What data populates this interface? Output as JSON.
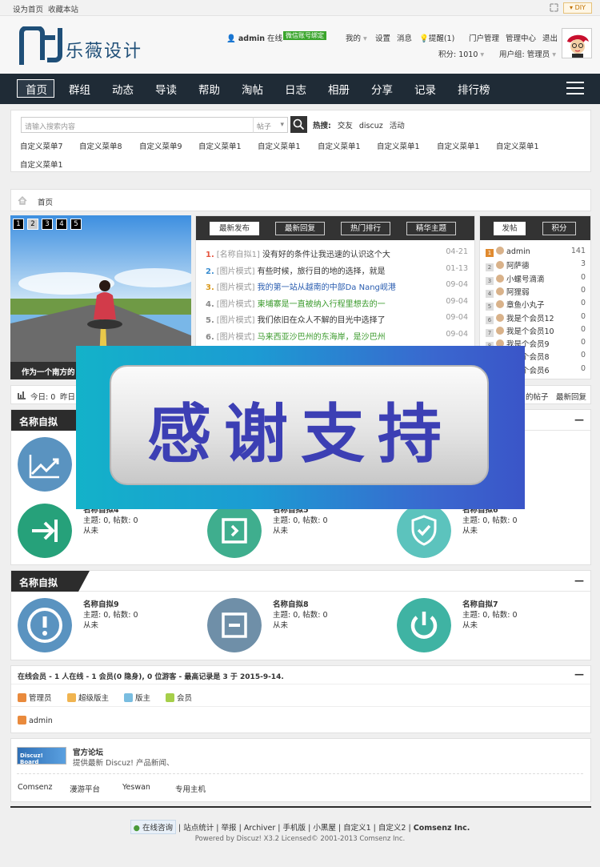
{
  "topbar": {
    "set_home": "设为首页",
    "bookmark": "收藏本站",
    "diy": "DIY"
  },
  "header": {
    "logo_text": "乐薇设计",
    "user": "admin",
    "online": "在线",
    "wechat": "微信账号绑定",
    "my": "我的",
    "settings": "设置",
    "messages": "消息",
    "remind": "提醒(1)",
    "portal_admin": "门户管理",
    "admin_center": "管理中心",
    "logout": "退出",
    "points": "积分: 1010",
    "usergroup": "用户组: 管理员"
  },
  "nav": [
    "首页",
    "群组",
    "动态",
    "导读",
    "帮助",
    "淘帖",
    "日志",
    "相册",
    "分享",
    "记录",
    "排行榜"
  ],
  "search": {
    "placeholder": "请输入搜索内容",
    "type": "帖子",
    "hot_label": "热搜:",
    "hot": [
      "交友",
      "discuz",
      "活动"
    ]
  },
  "menus": [
    "自定义菜单7",
    "自定义菜单8",
    "自定义菜单9",
    "自定义菜单1",
    "自定义菜单1",
    "自定义菜单1",
    "自定义菜单1",
    "自定义菜单1",
    "自定义菜单1",
    "自定义菜单1"
  ],
  "breadcrumb": "首页",
  "slider": {
    "dots": [
      "1",
      "2",
      "3",
      "4",
      "5"
    ],
    "caption": "作为一个南方的"
  },
  "center_tabs": [
    "最新发布",
    "最新回复",
    "热门排行",
    "精华主题"
  ],
  "threads": [
    {
      "n": "1.",
      "cat": "[名称自拟1]",
      "title": "没有好的条件让我迅速的认识这个大",
      "date": "04-21",
      "color": "#333",
      "numc": "#e5553f"
    },
    {
      "n": "2.",
      "cat": "[图片模式]",
      "title": "有些时候，旅行目的地的选择，就是",
      "date": "01-13",
      "color": "#333",
      "numc": "#3a8dd0"
    },
    {
      "n": "3.",
      "cat": "[图片模式]",
      "title": "我的第一站从越南的中部Da Nang岘港",
      "date": "09-04",
      "color": "#2a5db0",
      "numc": "#d99a1e"
    },
    {
      "n": "4.",
      "cat": "[图片模式]",
      "title": "柬埔寨是一直被纳入行程里想去的一",
      "date": "09-04",
      "color": "#3a9a2b",
      "numc": "#888"
    },
    {
      "n": "5.",
      "cat": "[图片模式]",
      "title": "我们依旧在众人不解的目光中选择了",
      "date": "09-04",
      "color": "#333",
      "numc": "#888"
    },
    {
      "n": "6.",
      "cat": "[图片模式]",
      "title": "马来西亚沙巴州的东海岸，是沙巴州",
      "date": "09-04",
      "color": "#3a9a2b",
      "numc": "#888"
    }
  ],
  "right_tabs": [
    "发帖",
    "积分"
  ],
  "ranks": [
    {
      "k": "1",
      "name": "admin",
      "count": "141"
    },
    {
      "k": "2",
      "name": "阿萨德",
      "count": "3"
    },
    {
      "k": "3",
      "name": "小螺号滴滴",
      "count": "0"
    },
    {
      "k": "4",
      "name": "阿狸弱",
      "count": "0"
    },
    {
      "k": "5",
      "name": "章鱼小丸子",
      "count": "0"
    },
    {
      "k": "6",
      "name": "我是个会员12",
      "count": "0"
    },
    {
      "k": "7",
      "name": "我是个会员10",
      "count": "0"
    },
    {
      "k": "8",
      "name": "我是个会员9",
      "count": "0"
    },
    {
      "k": "9",
      "name": "我是个会员8",
      "count": "0"
    },
    {
      "k": "10",
      "name": "我是个会员6",
      "count": "0"
    }
  ],
  "stats": {
    "today": "今日: 0",
    "yesterday": "昨日",
    "mine": "的帖子",
    "latest": "最新回复"
  },
  "overlay_text": "感谢支持",
  "sections": [
    {
      "title": "名称自拟",
      "forums": [
        {
          "name": "名称自拟4",
          "stat": "主题: 0, 帖数: 0",
          "last": "从未"
        },
        {
          "name": "名称自拟5",
          "stat": "主题: 0, 帖数: 0",
          "last": "从未"
        },
        {
          "name": "名称自拟6",
          "stat": "主题: 0, 帖数: 0",
          "last": "从未"
        }
      ]
    },
    {
      "title": "名称自拟",
      "forums": [
        {
          "name": "名称自拟9",
          "stat": "主题: 0, 帖数: 0",
          "last": "从未"
        },
        {
          "name": "名称自拟8",
          "stat": "主题: 0, 帖数: 0",
          "last": "从未"
        },
        {
          "name": "名称自拟7",
          "stat": "主题: 0, 帖数: 0",
          "last": "从未"
        }
      ]
    }
  ],
  "online": {
    "text": "在线会员 - 1 人在线 - 1 会员(0 隐身), 0 位游客 - 最高记录是 3 于 2015-9-14.",
    "legend": [
      "管理员",
      "超级版主",
      "版主",
      "会员"
    ],
    "member": "admin"
  },
  "links": {
    "badge": "Discuz! Board",
    "title": "官方论坛",
    "desc": "提供最新 Discuz! 产品新闻、",
    "items": [
      "Comsenz",
      "漫游平台",
      "Yeswan",
      "专用主机"
    ]
  },
  "footer": {
    "consult": "在线咨询",
    "items": [
      "站点统计",
      "举报",
      "Archiver",
      "手机版",
      "小黑屋",
      "自定义1",
      "自定义2"
    ],
    "company": "Comsenz Inc.",
    "powered": "Powered by Discuz! X3.2 Licensed© 2001-2013 Comsenz Inc."
  },
  "colors": {
    "nav_bg": "#1f2b36",
    "brand": "#1f4f78",
    "overlay_text": "#3c3fb4"
  }
}
